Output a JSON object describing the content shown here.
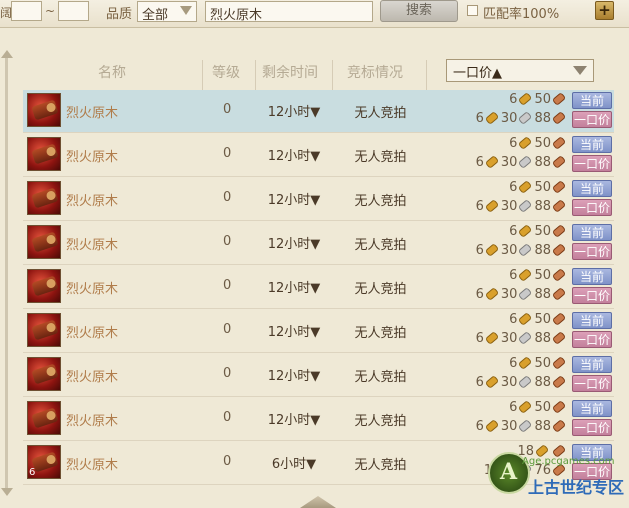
{
  "filter": {
    "level_label": "阔",
    "level_sep": "~",
    "quality_label": "品质",
    "quality_value": "全部",
    "search_text": "烈火原木",
    "search_button": "搜索",
    "match_label": "匹配率100%",
    "plus_label": "+"
  },
  "headers": {
    "name": "名称",
    "level": "等级",
    "time": "剩余时间",
    "bid": "竞标情况",
    "sort_value": "一口价▲"
  },
  "rows": [
    {
      "name": "烈火原木",
      "level": "0",
      "time": "12小时▼",
      "bid": "无人竞拍",
      "p1_g": "6",
      "p1_c": "50",
      "p2_g": "6",
      "p2_s": "30",
      "p2_c": "88",
      "btn_cur": "当前",
      "btn_buy": "一口价"
    },
    {
      "name": "烈火原木",
      "level": "0",
      "time": "12小时▼",
      "bid": "无人竞拍",
      "p1_g": "6",
      "p1_c": "50",
      "p2_g": "6",
      "p2_s": "30",
      "p2_c": "88",
      "btn_cur": "当前",
      "btn_buy": "一口价"
    },
    {
      "name": "烈火原木",
      "level": "0",
      "time": "12小时▼",
      "bid": "无人竞拍",
      "p1_g": "6",
      "p1_c": "50",
      "p2_g": "6",
      "p2_s": "30",
      "p2_c": "88",
      "btn_cur": "当前",
      "btn_buy": "一口价"
    },
    {
      "name": "烈火原木",
      "level": "0",
      "time": "12小时▼",
      "bid": "无人竞拍",
      "p1_g": "6",
      "p1_c": "50",
      "p2_g": "6",
      "p2_s": "30",
      "p2_c": "88",
      "btn_cur": "当前",
      "btn_buy": "一口价"
    },
    {
      "name": "烈火原木",
      "level": "0",
      "time": "12小时▼",
      "bid": "无人竞拍",
      "p1_g": "6",
      "p1_c": "50",
      "p2_g": "6",
      "p2_s": "30",
      "p2_c": "88",
      "btn_cur": "当前",
      "btn_buy": "一口价"
    },
    {
      "name": "烈火原木",
      "level": "0",
      "time": "12小时▼",
      "bid": "无人竞拍",
      "p1_g": "6",
      "p1_c": "50",
      "p2_g": "6",
      "p2_s": "30",
      "p2_c": "88",
      "btn_cur": "当前",
      "btn_buy": "一口价"
    },
    {
      "name": "烈火原木",
      "level": "0",
      "time": "12小时▼",
      "bid": "无人竞拍",
      "p1_g": "6",
      "p1_c": "50",
      "p2_g": "6",
      "p2_s": "30",
      "p2_c": "88",
      "btn_cur": "当前",
      "btn_buy": "一口价"
    },
    {
      "name": "烈火原木",
      "level": "0",
      "time": "12小时▼",
      "bid": "无人竞拍",
      "p1_g": "6",
      "p1_c": "50",
      "p2_g": "6",
      "p2_s": "30",
      "p2_c": "88",
      "btn_cur": "当前",
      "btn_buy": "一口价"
    },
    {
      "name": "烈火原木",
      "level": "0",
      "time": "6小时▼",
      "bid": "无人竞拍",
      "p1_g": "18",
      "p1_c": "",
      "p2_g": "18",
      "p2_s": "",
      "p2_c": "76",
      "btn_cur": "当前",
      "btn_buy": "一口价",
      "count": "6"
    }
  ],
  "watermark": {
    "site": "Age.pcgames.com",
    "name": "上古世纪专区"
  },
  "colors": {
    "selected_row": "#c9dde0",
    "name_text": "#b07c4a",
    "cur_button": "#7f92c8",
    "buy_button": "#c3809c"
  }
}
